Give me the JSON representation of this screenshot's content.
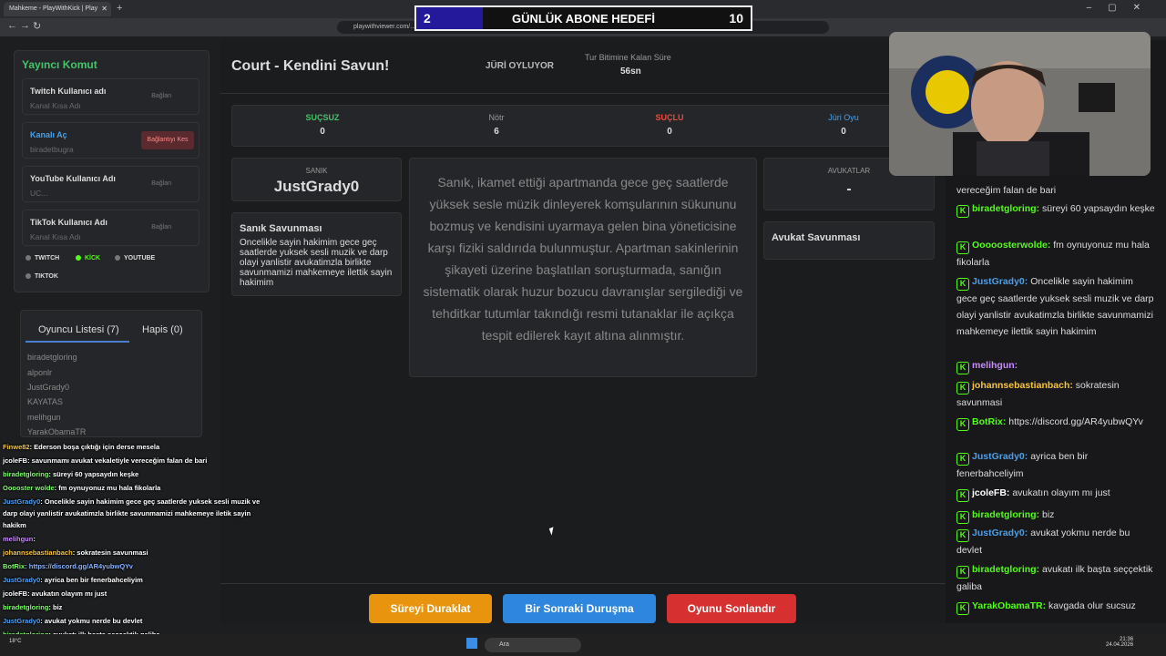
{
  "browser": {
    "tab_title": "Mahkeme - PlayWithKick | Play",
    "url": "playwithviewer.com/..."
  },
  "banner": {
    "left": "2",
    "title": "GÜNLÜK ABONE HEDEFİ",
    "right": "10",
    "progress": 0.2
  },
  "left_panel": {
    "title": "Yayıncı Komut",
    "accounts": [
      {
        "title": "Twitch Kullanıcı adı",
        "value": "Kanal Kısa Adı",
        "button": "Bağlan"
      },
      {
        "title": "Kanalı Aç",
        "value": "biradetbugra",
        "button": "Bağlantıyı Kes"
      },
      {
        "title": "YouTube Kullanıcı Adı",
        "value": "UC...",
        "button": "Bağlan"
      },
      {
        "title": "TikTok Kullanıcı Adı",
        "value": "Kanal Kısa Adı",
        "button": "Bağlan"
      }
    ],
    "platforms": [
      "TWITCH",
      "KİCK",
      "YOUTUBE",
      "TIKTOK"
    ],
    "tabs": {
      "players": "Oyuncu Listesi (7)",
      "jail": "Hapis (0)"
    },
    "players": [
      "biradetgloring",
      "alponlr",
      "JustGrady0",
      "KAYATAS",
      "melihgun",
      "YarakObamaTR"
    ]
  },
  "overlay_chat": [
    {
      "user": "Finwe82",
      "text": ": Ederson boşa çıktığı için derse mesela",
      "color": "#f5c542"
    },
    {
      "user": "jcoleFB",
      "text": ": savunmamı avukat vekaletiyle vereceğim falan de bari",
      "color": "#ffffff"
    },
    {
      "user": "biradetgloring",
      "text": ": süreyi 60 yapsaydın keşke",
      "color": "#7cfc6a"
    },
    {
      "user": "Ooooster wolde",
      "text": ": fm oynuyonuz mu hala fikolarla",
      "color": "#7cfc6a"
    },
    {
      "user": "JustGrady0",
      "text": ": Oncelikle sayin hakimim gece geç saatlerde yuksek sesli muzik ve",
      "color": "#4aa3ff"
    },
    {
      "user": "",
      "text": "darp olayi yanlistir avukatimzla birlikte savunmamizi mahkemeye iletik sayin",
      "color": "#ffffff"
    },
    {
      "user": "",
      "text": "hakikm",
      "color": "#ffffff"
    },
    {
      "user": "melihgun",
      "text": ":",
      "color": "#c98bff"
    },
    {
      "user": "johannsebastianbach",
      "text": ": sokratesin savunmasi",
      "color": "#f5c542"
    },
    {
      "user": "BotRix",
      "text": ": https://discord.gg/AR4yubwQYv",
      "color": "#7cfc6a"
    },
    {
      "user": "JustGrady0",
      "text": ": ayrica ben bir fenerbahceliyim",
      "color": "#4aa3ff"
    },
    {
      "user": "jcoleFB",
      "text": ": avukatın olayım mı just",
      "color": "#ffffff"
    },
    {
      "user": "biradetgloring",
      "text": ": biz",
      "color": "#7cfc6a"
    },
    {
      "user": "JustGrady0",
      "text": ": avukat yokmu nerde bu devlet",
      "color": "#4aa3ff"
    },
    {
      "user": "biradetgloring",
      "text": ": avukatı ilk başta seççektik galiba",
      "color": "#7cfc6a"
    },
    {
      "user": "YarakObamaTR",
      "text": ": kavgada olur sucsuz",
      "color": "#7cfc6a"
    }
  ],
  "court": {
    "title": "Court - Kendini Savun!",
    "phase": "JÜRİ OYLUYOR",
    "timer_label": "Tur Bitimine Kalan Süre",
    "timer_value": "56sn",
    "stats": [
      {
        "label": "SUÇSUZ",
        "value": "0",
        "color": "#46c36b"
      },
      {
        "label": "Nötr",
        "value": "6",
        "color": "#999999"
      },
      {
        "label": "SUÇLU",
        "value": "0",
        "color": "#e74c3c"
      },
      {
        "label": "Jüri Oyu",
        "value": "0",
        "color": "#4a9fe8"
      }
    ],
    "defendant_label": "SANIK",
    "defendant_name": "JustGrady0",
    "defense_title": "Sanık Savunması",
    "defense_text": "Oncelikle sayin hakimim gece geç saatlerde yuksek sesli muzik ve darp olayi yanlistir avukatimzla birlikte savunmamizi mahkemeye ilettik sayin hakimim",
    "charge_text": "Sanık, ikamet ettiği apartmanda gece geç saatlerde yüksek sesle müzik dinleyerek komşularının sükununu bozmuş ve kendisini uyarmaya gelen bina yöneticisine karşı fiziki saldırıda bulunmuştur. Apartman sakinlerinin şikayeti üzerine başlatılan soruşturmada, sanığın sistematik olarak huzur bozucu davranışlar sergilediği ve tehditkar tutumlar takındığı resmi tutanaklar ile açıkça tespit edilerek kayıt altına alınmıştır.",
    "lawyers_label": "AVUKATLAR",
    "lawyers_value": "-",
    "lawyer_defense_title": "Avukat Savunması"
  },
  "buttons": {
    "pause": "Süreyi Duraklat",
    "next": "Bir Sonraki Duruşma",
    "end": "Oyunu Sonlandır"
  },
  "chat": [
    {
      "user": "",
      "text": "vereceğim falan de bari",
      "color": "#ddd",
      "badge": false
    },
    {
      "user": "biradetgloring:",
      "text": " süreyi 60 yapsaydın keşke",
      "color": "#53fc18",
      "badge": true
    },
    {
      "user": "Ooooosterwolde:",
      "text": " fm oynuyonuz mu hala fikolarla",
      "color": "#53fc18",
      "badge": true
    },
    {
      "user": "JustGrady0:",
      "text": " Oncelikle sayin hakimim gece geç saatlerde yuksek sesli muzik ve darp olayi yanlistir avukatimzla birlikte savunmamizi mahkemeye ilettik sayin hakimim",
      "color": "#4a9fe8",
      "badge": true
    },
    {
      "user": "melihgun:",
      "text": "",
      "color": "#c98bff",
      "badge": true
    },
    {
      "user": "johannsebastianbach:",
      "text": " sokratesin savunmasi",
      "color": "#f5c542",
      "badge": true
    },
    {
      "user": "BotRix:",
      "text": " https://discord.gg/AR4yubwQYv",
      "color": "#53fc18",
      "badge": true
    },
    {
      "user": "JustGrady0:",
      "text": " ayrica ben bir fenerbahceliyim",
      "color": "#4a9fe8",
      "badge": true
    },
    {
      "user": "jcoleFB:",
      "text": " avukatın olayım mı just",
      "color": "#ffffff",
      "badge": true
    },
    {
      "user": "biradetgloring:",
      "text": " biz",
      "color": "#53fc18",
      "badge": true
    },
    {
      "user": "JustGrady0:",
      "text": " avukat yokmu nerde bu devlet",
      "color": "#4a9fe8",
      "badge": true
    },
    {
      "user": "biradetgloring:",
      "text": " avukatı ilk başta seççektik galiba",
      "color": "#53fc18",
      "badge": true
    },
    {
      "user": "YarakObamaTR:",
      "text": " kavgada olur sucsuz",
      "color": "#53fc18",
      "badge": true
    }
  ],
  "taskbar": {
    "search": "Ara",
    "time": "21:36",
    "date": "24.04.2026",
    "weather": "18°C"
  }
}
